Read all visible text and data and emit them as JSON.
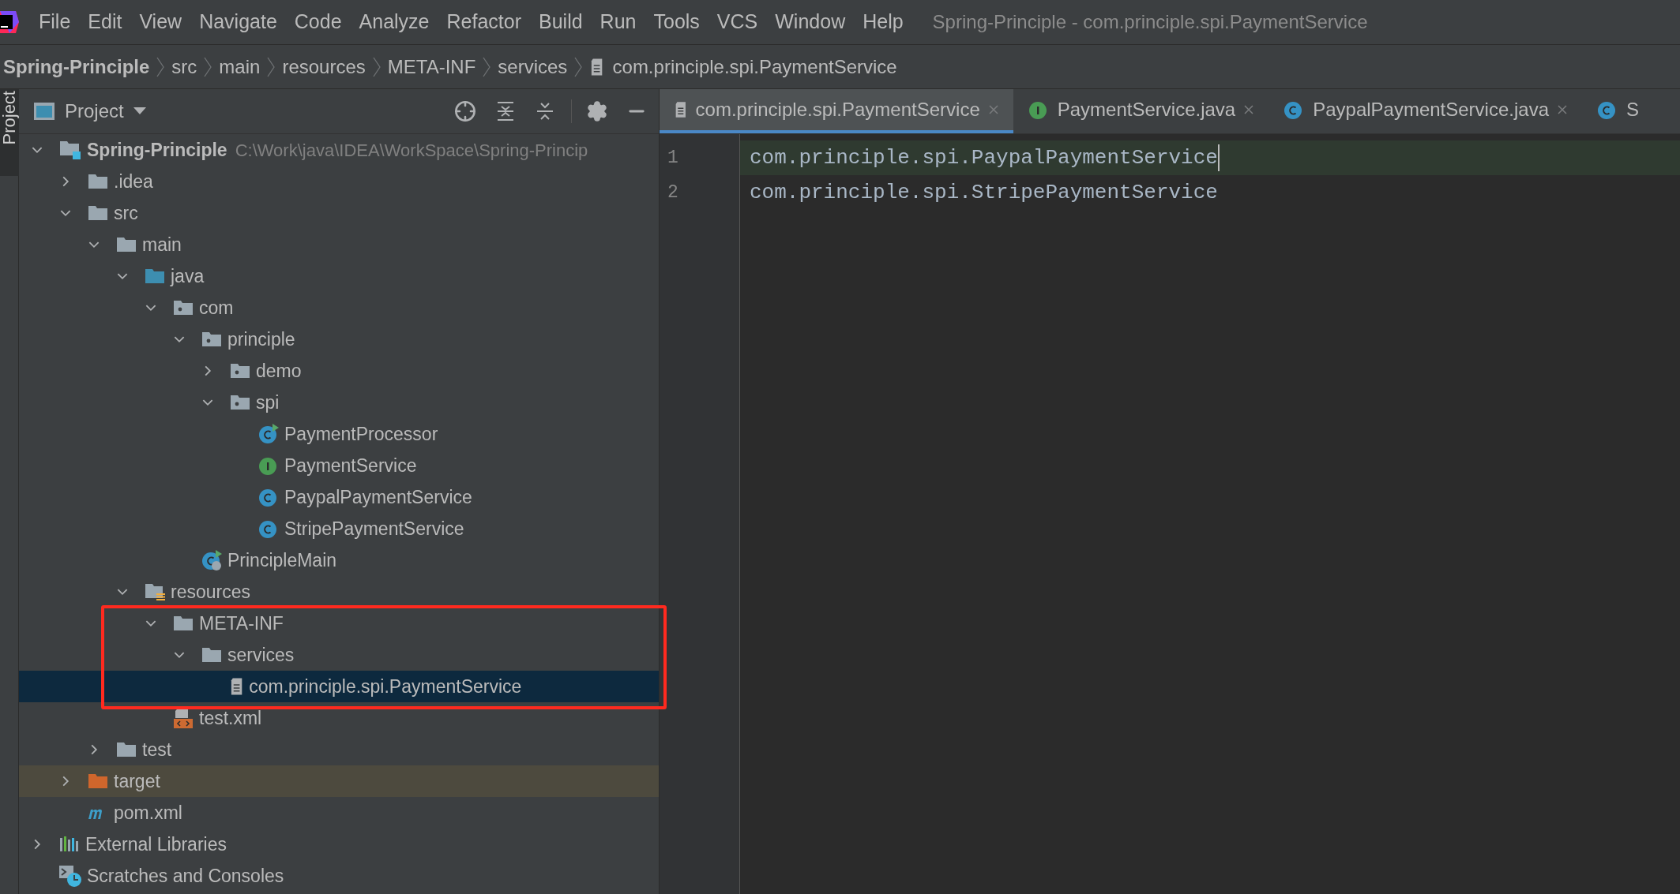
{
  "menu_bar": {
    "items": [
      "File",
      "Edit",
      "View",
      "Navigate",
      "Code",
      "Analyze",
      "Refactor",
      "Build",
      "Run",
      "Tools",
      "VCS",
      "Window",
      "Help"
    ],
    "window_title": "Spring-Principle - com.principle.spi.PaymentService"
  },
  "breadcrumbs": [
    {
      "label": "Spring-Principle",
      "kind": "project"
    },
    {
      "label": "src",
      "kind": "folder"
    },
    {
      "label": "main",
      "kind": "folder"
    },
    {
      "label": "resources",
      "kind": "folder"
    },
    {
      "label": "META-INF",
      "kind": "folder"
    },
    {
      "label": "services",
      "kind": "folder"
    },
    {
      "label": "com.principle.spi.PaymentService",
      "kind": "file"
    }
  ],
  "side_tab": {
    "label": "Project"
  },
  "project_panel": {
    "title": "Project",
    "tree": [
      {
        "label": "Spring-Principle",
        "path": "C:\\Work\\java\\IDEA\\WorkSpace\\Spring-Princip",
        "kind": "module",
        "expanded": true,
        "selected": false,
        "children": [
          {
            "label": ".idea",
            "kind": "folder",
            "expanded": false,
            "selected": false
          },
          {
            "label": "src",
            "kind": "folder",
            "expanded": true,
            "selected": false,
            "children": [
              {
                "label": "main",
                "kind": "folder",
                "expanded": true,
                "selected": false,
                "children": [
                  {
                    "label": "java",
                    "kind": "source-folder",
                    "expanded": true,
                    "selected": false,
                    "children": [
                      {
                        "label": "com",
                        "kind": "package",
                        "expanded": true,
                        "selected": false,
                        "children": [
                          {
                            "label": "principle",
                            "kind": "package",
                            "expanded": true,
                            "selected": false,
                            "children": [
                              {
                                "label": "demo",
                                "kind": "package",
                                "expanded": false,
                                "selected": false
                              },
                              {
                                "label": "spi",
                                "kind": "package",
                                "expanded": true,
                                "selected": false,
                                "children": [
                                  {
                                    "label": "PaymentProcessor",
                                    "kind": "runnable-class",
                                    "selected": false
                                  },
                                  {
                                    "label": "PaymentService",
                                    "kind": "interface",
                                    "selected": false
                                  },
                                  {
                                    "label": "PaypalPaymentService",
                                    "kind": "class",
                                    "selected": false
                                  },
                                  {
                                    "label": "StripePaymentService",
                                    "kind": "class",
                                    "selected": false
                                  }
                                ]
                              }
                            ]
                          },
                          {
                            "label": "PrincipleMain",
                            "kind": "spring-class",
                            "selected": false
                          }
                        ]
                      }
                    ]
                  },
                  {
                    "label": "resources",
                    "kind": "resources-folder",
                    "expanded": true,
                    "selected": false,
                    "children": [
                      {
                        "label": "META-INF",
                        "kind": "folder",
                        "expanded": true,
                        "selected": false,
                        "children": [
                          {
                            "label": "services",
                            "kind": "folder",
                            "expanded": true,
                            "selected": false,
                            "children": [
                              {
                                "label": "com.principle.spi.PaymentService",
                                "kind": "file",
                                "selected": true
                              }
                            ]
                          }
                        ]
                      },
                      {
                        "label": "test.xml",
                        "kind": "xml",
                        "selected": false
                      }
                    ]
                  }
                ]
              },
              {
                "label": "test",
                "kind": "folder",
                "expanded": false,
                "selected": false
              }
            ]
          },
          {
            "label": "target",
            "kind": "excluded-folder",
            "expanded": false,
            "selected": false
          },
          {
            "label": "pom.xml",
            "kind": "maven",
            "selected": false
          }
        ]
      },
      {
        "label": "External Libraries",
        "kind": "libraries",
        "expanded": false,
        "selected": false
      },
      {
        "label": "Scratches and Consoles",
        "kind": "scratches",
        "selected": false
      }
    ]
  },
  "editor": {
    "tabs": [
      {
        "label": "com.principle.spi.PaymentService",
        "kind": "file",
        "selected": true,
        "close_button": true
      },
      {
        "label": "PaymentService.java",
        "kind": "interface",
        "selected": false,
        "close_button": true
      },
      {
        "label": "PaypalPaymentService.java",
        "kind": "class",
        "selected": false,
        "close_button": true
      },
      {
        "label": "S",
        "kind": "class",
        "selected": false,
        "close_button": false
      }
    ],
    "lines": [
      {
        "number": "1",
        "text": "com.principle.spi.PaypalPaymentService",
        "current": true
      },
      {
        "number": "2",
        "text": "com.principle.spi.StripePaymentService",
        "current": false
      }
    ]
  }
}
